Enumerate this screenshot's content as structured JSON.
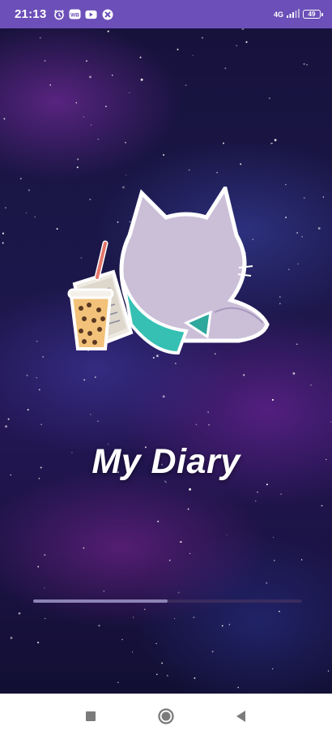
{
  "status_bar": {
    "time": "21:13",
    "left_icons": [
      "alarm-icon",
      "wb-icon",
      "youtube-icon",
      "app-x-icon"
    ],
    "network": "4G",
    "battery": "49",
    "bg_color": "#6c4fb8"
  },
  "splash": {
    "title": "My Diary",
    "progress": 0.5
  },
  "nav_bar": {
    "buttons": [
      "recents-square-icon",
      "home-circle-icon",
      "back-triangle-icon"
    ]
  }
}
